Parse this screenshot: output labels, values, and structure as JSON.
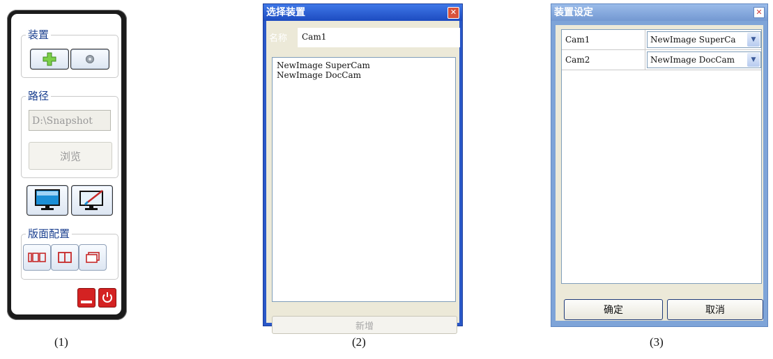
{
  "panel1": {
    "device_group_title": "装置",
    "path_group_title": "路径",
    "path_value": "D:\\Snapshot",
    "browse_label": "浏览",
    "layout_group_title": "版面配置",
    "icons": {
      "add": "plus-icon",
      "settings": "gear-icon",
      "monitor": "monitor-icon",
      "monitor_edit": "monitor-edit-icon",
      "layout_single": "layout-single-icon",
      "layout_split": "layout-split-icon",
      "layout_overlap": "layout-overlap-icon",
      "minimize": "minimize-icon",
      "power": "power-icon"
    },
    "colors": {
      "title_blue": "#1a3f8f",
      "red": "#d42222",
      "frame": "#1b1b1b"
    }
  },
  "panel2": {
    "title": "选择装置",
    "name_label": "名称",
    "name_value": "Cam1",
    "devices": [
      "NewImage SuperCam",
      "NewImage DocCam"
    ],
    "add_label": "新增",
    "colors": {
      "titlebar": "#2a58c8"
    }
  },
  "panel3": {
    "title": "装置设定",
    "rows": [
      {
        "name": "Cam1",
        "device": "NewImage SuperCa"
      },
      {
        "name": "Cam2",
        "device": "NewImage DocCam"
      }
    ],
    "ok_label": "确定",
    "cancel_label": "取消",
    "colors": {
      "titlebar": "#7ea4d8"
    }
  },
  "captions": [
    "(1)",
    "(2)",
    "(3)"
  ]
}
